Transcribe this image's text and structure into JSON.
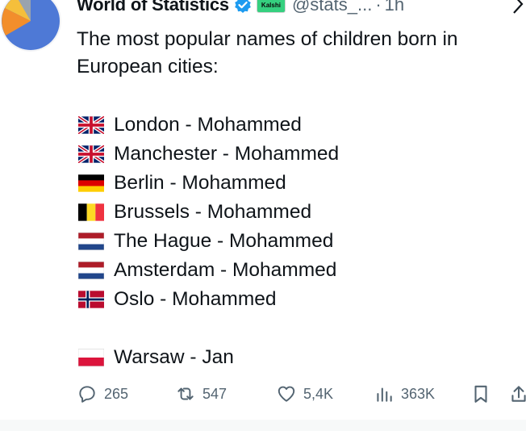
{
  "tweet": {
    "author_name": "World of Statistics",
    "affiliate_badge": "Kalshi",
    "handle": "@stats_...",
    "separator": "·",
    "time": "1h",
    "intro": "The most popular names of children born in European cities:",
    "cities": [
      {
        "flag": "uk-flag",
        "text": "London - Mohammed"
      },
      {
        "flag": "uk-flag",
        "text": "Manchester - Mohammed"
      },
      {
        "flag": "germany-flag",
        "text": "Berlin - Mohammed"
      },
      {
        "flag": "belgium-flag",
        "text": "Brussels - Mohammed"
      },
      {
        "flag": "netherlands-flag",
        "text": "The Hague - Mohammed"
      },
      {
        "flag": "netherlands-flag",
        "text": "Amsterdam - Mohammed"
      },
      {
        "flag": "norway-flag",
        "text": "Oslo - Mohammed"
      }
    ],
    "poland": {
      "flag": "poland-flag",
      "text": "Warsaw - Jan"
    }
  },
  "actions": {
    "replies": "265",
    "reposts": "547",
    "likes": "5,4K",
    "views": "363K"
  },
  "colors": {
    "text": "#0f1419",
    "secondary": "#536471",
    "verified": "#1d9bf0",
    "affiliate": "#35d07f"
  }
}
